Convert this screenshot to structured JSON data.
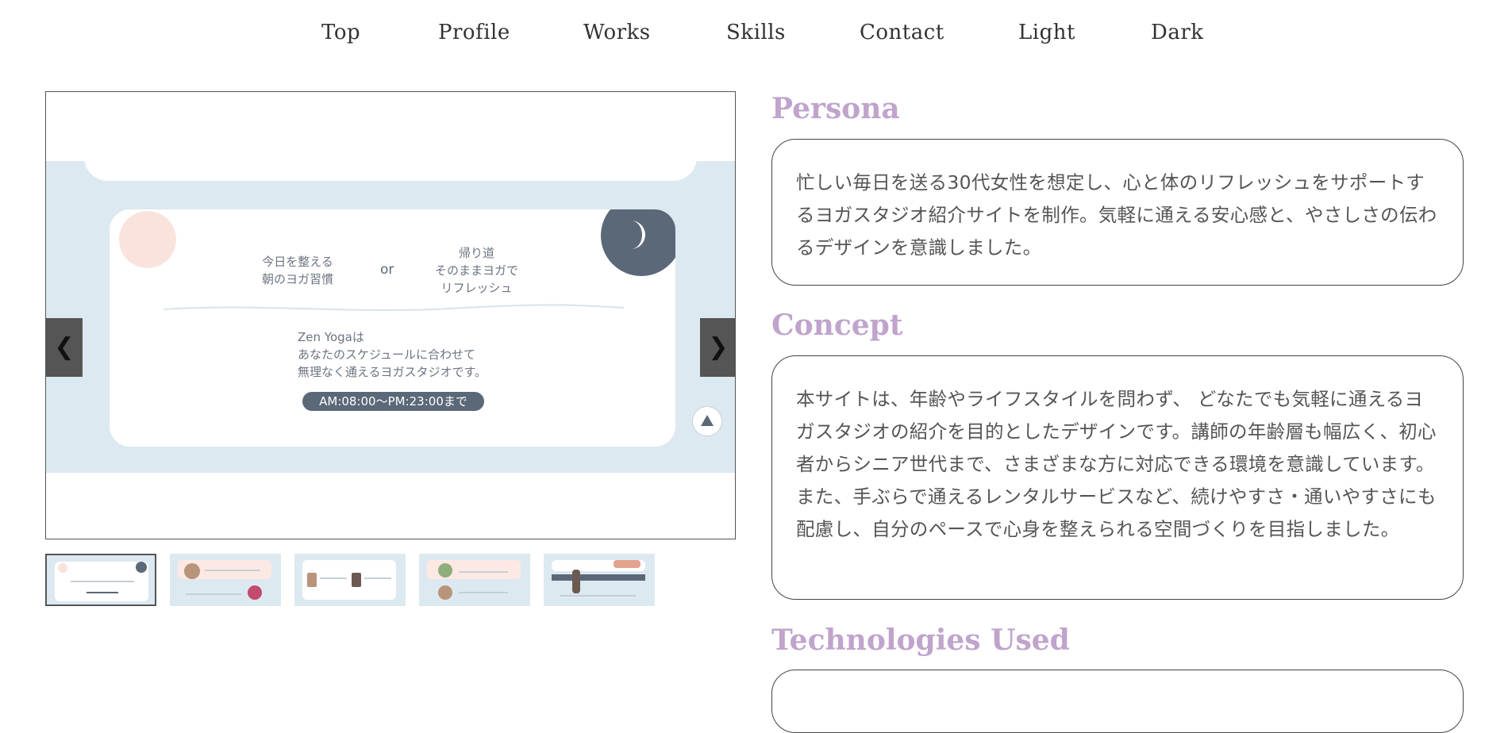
{
  "nav": {
    "items": [
      "Top",
      "Profile",
      "Works",
      "Skills",
      "Contact",
      "Light",
      "Dark"
    ]
  },
  "slider": {
    "slide": {
      "left_text_1": "今日を整える",
      "left_text_2": "朝のヨガ習慣",
      "or": "or",
      "right_text_1": "帰り道",
      "right_text_2": "そのままヨガで",
      "right_text_3": "リフレッシュ",
      "desc_1": "Zen Yogaは",
      "desc_2": "あなたのスケジュールに合わせて",
      "desc_3": "無理なく通えるヨガスタジオです。",
      "hours": "AM:08:00〜PM:23:00まで"
    },
    "prev_label": "❮",
    "next_label": "❯",
    "thumbnail_count": 5,
    "active_thumbnail": 1
  },
  "persona": {
    "title": "Persona",
    "text": "忙しい毎日を送る30代女性を想定し、心と体のリフレッシュをサポートするヨガスタジオ紹介サイトを制作。気軽に通える安心感と、やさしさの伝わるデザインを意識しました。"
  },
  "concept": {
    "title": "Concept",
    "text": "本サイトは、年齢やライフスタイルを問わず、 どなたでも気軽に通えるヨガスタジオの紹介を目的としたデザインです。講師の年齢層も幅広く、初心者からシニア世代まで、さまざまな方に対応できる環境を意識しています。また、手ぶらで通えるレンタルサービスなど、続けやすさ・通いやすさにも配慮し、自分のペースで心身を整えられる空間づくりを目指しました。"
  },
  "technologies": {
    "title": "Technologies Used"
  },
  "colors": {
    "accent": "#c0a4cc",
    "slide_bg": "#dde9f0",
    "slate": "#5b6878",
    "pink": "#fbe3dd"
  }
}
